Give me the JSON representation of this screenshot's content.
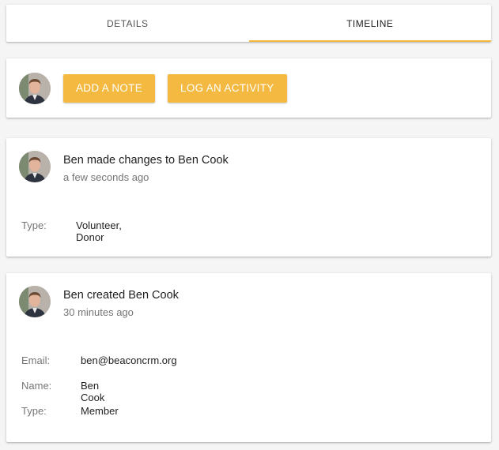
{
  "tabs": [
    {
      "label": "DETAILS",
      "active": false
    },
    {
      "label": "TIMELINE",
      "active": true
    }
  ],
  "actions": {
    "add_note_label": "ADD A NOTE",
    "log_activity_label": "LOG AN ACTIVITY"
  },
  "timeline": [
    {
      "title": "Ben made changes to Ben Cook",
      "time": "a few seconds ago",
      "fields": [
        {
          "label": "Type:",
          "value": "Volunteer, Donor"
        }
      ]
    },
    {
      "title": "Ben created Ben Cook",
      "time": "30 minutes ago",
      "fields": [
        {
          "label": "Email:",
          "value": "ben@beaconcrm.org"
        },
        {
          "label": "Name:",
          "value": "Ben Cook"
        },
        {
          "label": "Type:",
          "value": "Member"
        }
      ]
    }
  ],
  "colors": {
    "accent": "#f4b941",
    "background": "#f5f5f5"
  },
  "icons": {
    "avatar": "user-avatar"
  }
}
